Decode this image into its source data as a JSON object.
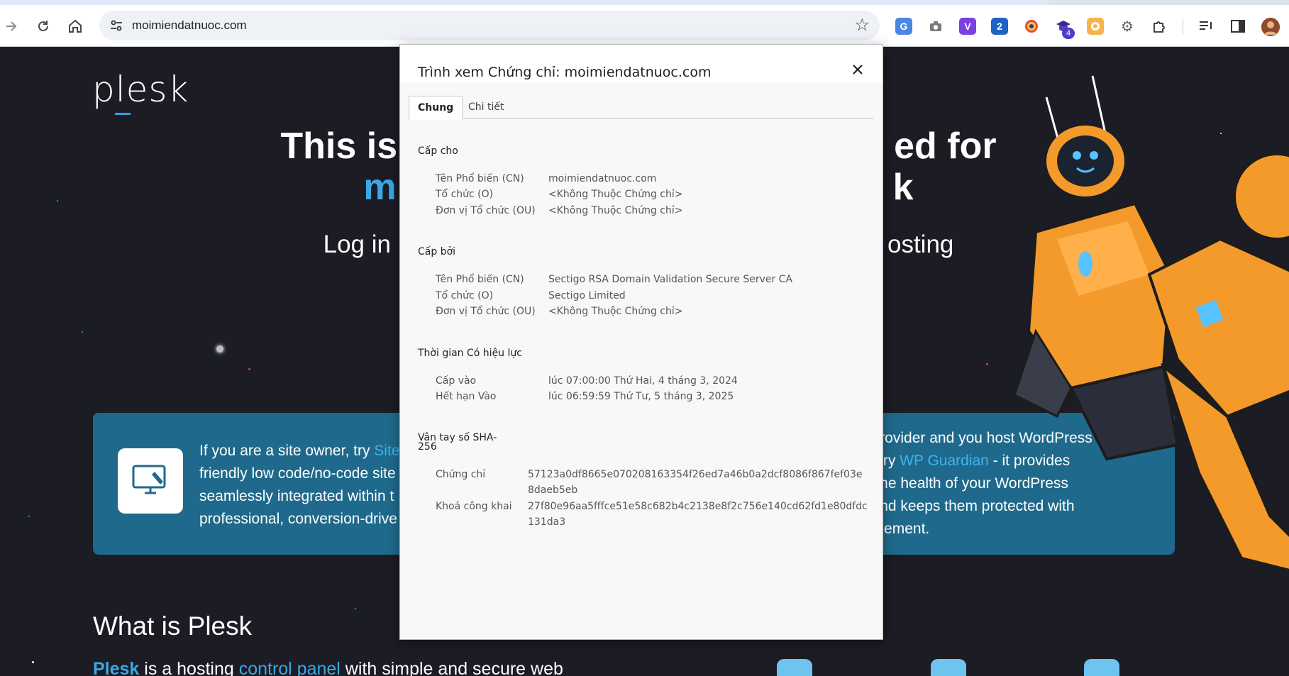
{
  "browser": {
    "url": "moimiendatnuoc.com",
    "nav": {
      "back_icon": "arrow-right-icon",
      "reload_icon": "reload-icon",
      "home_icon": "home-icon"
    },
    "extensions_badge": "4"
  },
  "page": {
    "logo": "plesk",
    "hero_line1_start": "This is",
    "hero_line1_end": "ed for",
    "hero_line2_start": "m",
    "hero_line2_end": "k",
    "hero_sub_start": "Log in",
    "hero_sub_end": "osting",
    "banner_left": [
      "If you are a site owner, try ",
      "Site",
      "friendly low code/no-code site",
      "seamlessly integrated within t",
      "professional, conversion-drive"
    ],
    "banner_right": [
      "e provider and you host WordPress",
      "k. Try ",
      "WP Guardian",
      " - it provides",
      "to the health of your WordPress",
      "e and keeps them protected with",
      "nagement."
    ],
    "what_title": "What is Plesk",
    "what_body_plesk": "Plesk",
    "what_body_mid": " is a hosting ",
    "what_body_link": "control panel",
    "what_body_end": " with simple and secure web"
  },
  "dialog": {
    "title": "Trình xem Chứng chỉ: moimiendatnuoc.com",
    "tabs": [
      "Chung",
      "Chi tiết"
    ],
    "issued_to": {
      "heading": "Cấp cho",
      "rows": [
        {
          "label": "Tên Phổ biến (CN)",
          "value": "moimiendatnuoc.com"
        },
        {
          "label": "Tổ chức (O)",
          "value": "<Không Thuộc Chứng chỉ>"
        },
        {
          "label": "Đơn vị Tổ chức (OU)",
          "value": "<Không Thuộc Chứng chỉ>"
        }
      ]
    },
    "issued_by": {
      "heading": "Cấp bởi",
      "rows": [
        {
          "label": "Tên Phổ biến (CN)",
          "value": "Sectigo RSA Domain Validation Secure Server CA"
        },
        {
          "label": "Tổ chức (O)",
          "value": "Sectigo Limited"
        },
        {
          "label": "Đơn vị Tổ chức (OU)",
          "value": "<Không Thuộc Chứng chỉ>"
        }
      ]
    },
    "validity": {
      "heading": "Thời gian Có hiệu lực",
      "rows": [
        {
          "label": "Cấp vào",
          "value": "lúc 07:00:00 Thứ Hai, 4 tháng 3, 2024"
        },
        {
          "label": "Hết hạn Vào",
          "value": "lúc 06:59:59 Thứ Tư, 5 tháng 3, 2025"
        }
      ]
    },
    "fingerprints": {
      "heading_line1": "Vân tay số SHA-",
      "heading_line2": "256",
      "rows": [
        {
          "label": "Chứng chỉ",
          "value": "57123a0df8665e070208163354f26ed7a46b0a2dcf8086f867fef03e8daeb5eb"
        },
        {
          "label": "Khoá công khai",
          "value": "27f80e96aa5fffce51e58c682b4c2138e8f2c756e140cd62fd1e80dfdc131da3"
        }
      ]
    }
  }
}
